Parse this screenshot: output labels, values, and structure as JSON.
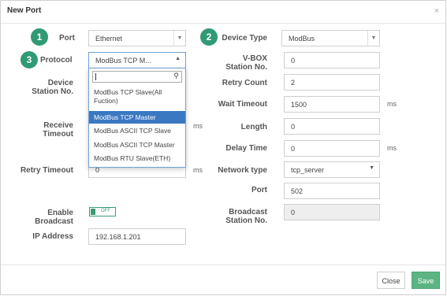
{
  "dialog": {
    "title": "New Port",
    "close_icon": "×"
  },
  "badges": [
    "1",
    "2",
    "3"
  ],
  "labels": {
    "port": "Port",
    "protocol": "Protocol",
    "device_station_1": "Device",
    "device_station_2": "Station No.",
    "receive_timeout_1": "Receive",
    "receive_timeout_2": "Timeout",
    "retry_timeout": "Retry Timeout",
    "enable_broadcast_1": "Enable",
    "enable_broadcast_2": "Broadcast",
    "ip_address": "IP Address",
    "device_type": "Device Type",
    "vbox_station_1": "V-BOX",
    "vbox_station_2": "Station No.",
    "retry_count": "Retry Count",
    "wait_timeout": "Wait Timeout",
    "length": "Length",
    "delay_time": "Delay Time",
    "network_type": "Network type",
    "port_right": "Port",
    "broadcast_station_1": "Broadcast",
    "broadcast_station_2": "Station No."
  },
  "fields": {
    "port": "Ethernet",
    "protocol": "ModBus TCP M...",
    "retry_timeout": "0",
    "ip_address": "192.168.1.201",
    "device_type": "ModBus",
    "vbox_station": "0",
    "retry_count": "2",
    "wait_timeout": "1500",
    "length": "0",
    "delay_time": "0",
    "network_type": "tcp_server",
    "port_number": "502",
    "broadcast_station": "0"
  },
  "units": {
    "ms": "ms"
  },
  "toggle": {
    "label": "OFF",
    "state": "off"
  },
  "protocol_dropdown": {
    "search_value": "",
    "options": [
      "ModBus TCP Slave(All Fuction)",
      "ModBus TCP Master",
      "ModBus ASCII TCP Slave",
      "ModBus ASCII TCP Master",
      "ModBus RTU Slave(ETH)"
    ],
    "highlighted_index": 1
  },
  "buttons": {
    "close": "Close",
    "save": "Save"
  },
  "colors": {
    "accent": "#2f9a74",
    "highlight": "#3b78c2",
    "save": "#5cb483"
  }
}
